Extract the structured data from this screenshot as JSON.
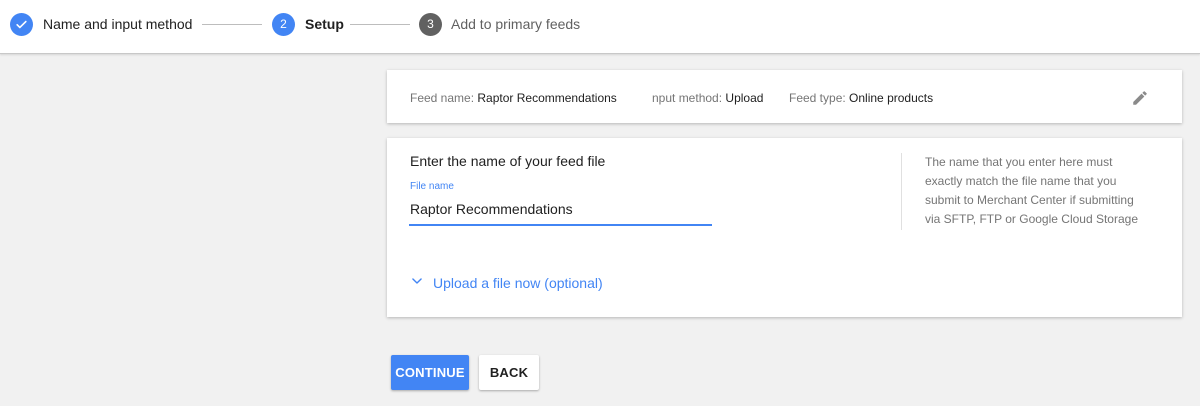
{
  "stepper": {
    "steps": [
      {
        "number": "",
        "label": "Name and input method",
        "state": "completed",
        "icon": "check-icon"
      },
      {
        "number": "2",
        "label": "Setup",
        "state": "active"
      },
      {
        "number": "3",
        "label": "Add to primary feeds",
        "state": "upcoming"
      }
    ]
  },
  "summary": {
    "feed_name_key": "Feed name:",
    "feed_name_value": "Raptor Recommendations",
    "input_method_key": "nput method:",
    "input_method_value": "Upload",
    "feed_type_key": "Feed type:",
    "feed_type_value": "Online products",
    "edit_icon": "pencil-icon"
  },
  "form": {
    "heading": "Enter the name of your feed file",
    "field_label": "File name",
    "field_value": "Raptor Recommendations",
    "help_text": "The name that you enter here must exactly match the file name that you submit to Merchant Center if submitting via SFTP, FTP or Google Cloud Storage",
    "upload_toggle_label": "Upload a file now (optional)",
    "upload_toggle_icon": "chevron-down-icon"
  },
  "actions": {
    "continue_label": "CONTINUE",
    "back_label": "BACK"
  },
  "colors": {
    "accent": "#4285f4",
    "inactive_step": "#616161",
    "background": "#f1f1f1"
  }
}
